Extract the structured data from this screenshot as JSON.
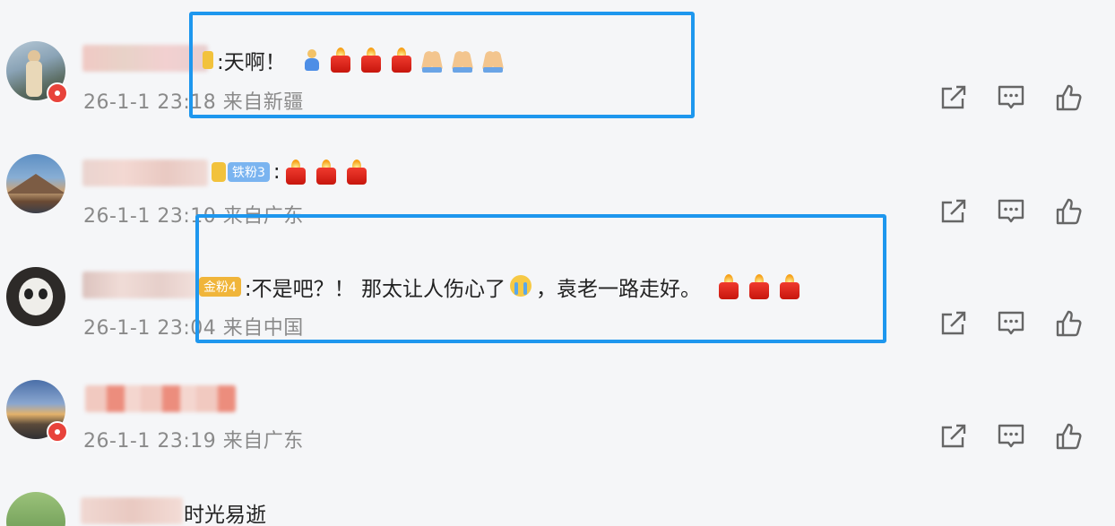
{
  "comments": [
    {
      "text": ":天啊！",
      "emoji": [
        "person-icon",
        "candle-icon",
        "candle-icon",
        "candle-icon",
        "pray-icon",
        "pray-icon",
        "pray-icon"
      ],
      "time": "26-1-1 23:18",
      "location": "来自新疆"
    },
    {
      "fan_badge": "铁粉3",
      "text": ":",
      "emoji": [
        "candle-icon",
        "candle-icon",
        "candle-icon"
      ],
      "time": "26-1-1 23:10",
      "location": "来自广东"
    },
    {
      "fan_badge": "金粉4",
      "text": ":不是吧？！ 那太让人伤心了",
      "text_after": "，袁老一路走好。",
      "emoji": [
        "candle-icon",
        "candle-icon",
        "candle-icon"
      ],
      "time": "26-1-1 23:04",
      "location": "来自中国"
    },
    {
      "time": "26-1-1 23:19",
      "location": "来自广东"
    },
    {
      "text": "时光易逝"
    }
  ],
  "actions": [
    "share-icon",
    "comment-icon",
    "like-icon"
  ],
  "colors": {
    "highlight": "#1e97ee",
    "meta_text": "#8a8a8a",
    "background": "#f5f6f8",
    "verified_badge": "#e8433b"
  }
}
